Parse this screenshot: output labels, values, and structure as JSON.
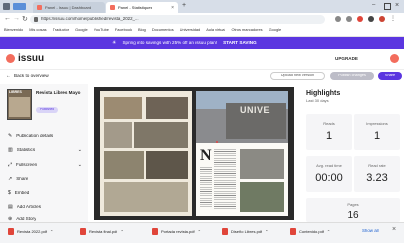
{
  "browser": {
    "tabs": [
      {
        "title": "Panel - Issuu | Dashboard"
      },
      {
        "title": "Panel - Statistiques"
      },
      {
        "title": "Nuevo"
      }
    ],
    "url": "https://issuu.com/home/published/revista_2022_...",
    "bookmarks": [
      "Bienvenido",
      "Mis cosas",
      "Traductor",
      "Google",
      "YouTube",
      "Facebook",
      "Blog",
      "Documentos",
      "Universidad",
      "Aula virtual",
      "Otros marcadores",
      "Google"
    ]
  },
  "promo": {
    "text": "Spring into savings with 25% off an issuu plan!",
    "cta": "START SAVING"
  },
  "header": {
    "logo": "issuu",
    "upgrade_label": "UPGRADE"
  },
  "subheader": {
    "back_label": "Back to overview",
    "new_version_label": "Upload new version",
    "publish_label": "Publish changes",
    "share_label": "Share"
  },
  "doc": {
    "cover_label": "LIBRES",
    "title": "Revista Libres Mayo",
    "badge": "Published"
  },
  "sidebar": {
    "items": [
      "Publication details",
      "Statistics",
      "Fullscreen",
      "Share",
      "Embed",
      "Add Articles",
      "Add Story",
      "Social posts"
    ]
  },
  "magazine": {
    "heading": "N",
    "building_sign": "UNIVE"
  },
  "highlights": {
    "title": "Highlights",
    "subtitle": "Last 30 days",
    "stats": [
      {
        "label": "Reads",
        "value": "1"
      },
      {
        "label": "Impressions",
        "value": "1"
      },
      {
        "label": "Avg. read time",
        "value": "00:00"
      },
      {
        "label": "Read rate",
        "value": "3.23"
      },
      {
        "label": "Pages",
        "value": "16"
      }
    ]
  },
  "downloads": {
    "files": [
      "Revista 2022.pdf",
      "Revista final.pdf",
      "Portada revista.pdf",
      "Diseño Libres.pdf",
      "Contenido.pdf"
    ],
    "show_all": "Show all"
  },
  "colors": {
    "accent": "#5b36e0",
    "brand": "#f36d5d",
    "download_icon": "#e0453a"
  }
}
